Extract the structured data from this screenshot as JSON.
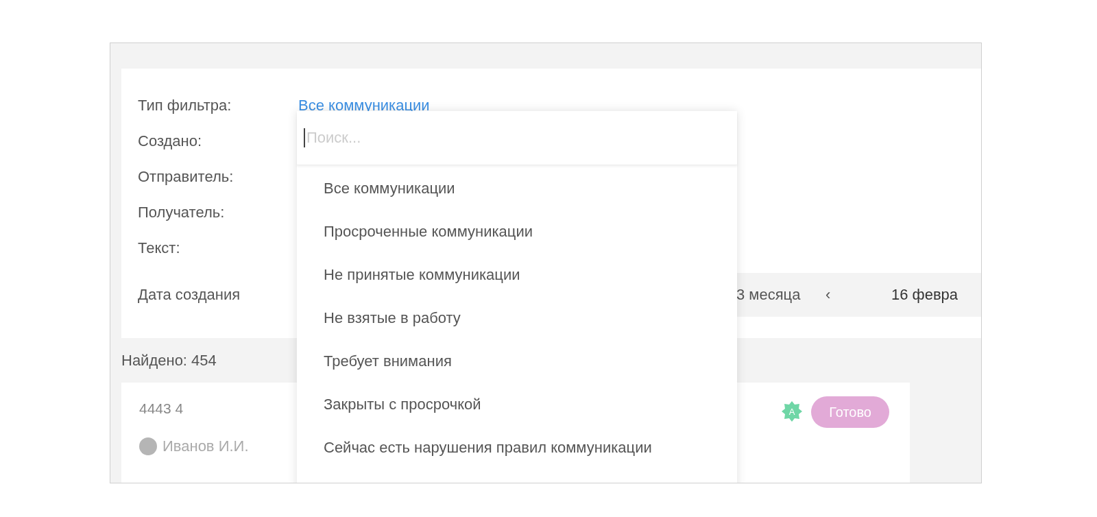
{
  "filter_panel": {
    "fields": [
      {
        "label": "Тип фильтра:",
        "value": "Все коммуникации"
      },
      {
        "label": "Создано:"
      },
      {
        "label": "Отправитель:"
      },
      {
        "label": "Получатель:"
      },
      {
        "label": "Текст:"
      }
    ],
    "date_row": {
      "label": "Дата создания",
      "period": "3 месяца",
      "prev": "‹",
      "date": "16 февра"
    }
  },
  "filter_dropdown": {
    "search": {
      "placeholder": "Поиск..."
    },
    "options": [
      "Все коммуникации",
      "Просроченные коммуникации",
      "Не принятые коммуникации",
      "Не взятые в работу",
      "Требует внимания",
      "Закрыты с просрочкой",
      "Сейчас есть нарушения правил коммуникации"
    ]
  },
  "results": {
    "found": "Найдено: 454",
    "items": [
      {
        "number": "4443 4",
        "author": "Иванов И.И.",
        "badge": "A",
        "status": "Готово"
      }
    ]
  }
}
